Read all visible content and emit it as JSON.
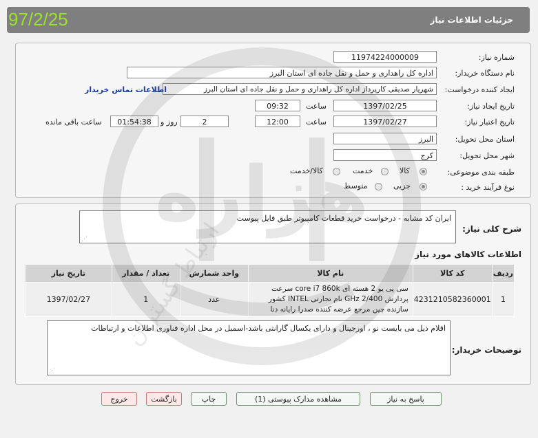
{
  "header": {
    "title": "جزئیات اطلاعات نیاز",
    "date_stamp": "97/2/25"
  },
  "form": {
    "need_number_label": "شماره نیاز:",
    "need_number": "11974224000009",
    "buyer_org_label": "نام دستگاه خریدار:",
    "buyer_org": "اداره کل راهداری و حمل و نقل جاده ای استان البرز",
    "creator_label": "ایجاد کننده درخواست:",
    "creator": "شهریار  صدیقی  کارپرداز  اداره کل راهداری و حمل و نقل جاده ای استان البرز",
    "contact_link": "اطلاعات تماس خریدار",
    "created_date_label": "تاریخ ایجاد نیاز:",
    "created_date": "1397/02/25",
    "time_label": "ساعت",
    "created_time": "09:32",
    "valid_date_label": "تاریخ اعتبار نیاز:",
    "valid_date": "1397/02/27",
    "valid_time": "12:00",
    "days": "2",
    "days_label": "روز و",
    "remaining_time": "01:54:38",
    "remaining_label": "ساعت باقی مانده",
    "province_label": "استان محل تحویل:",
    "province": "البرز",
    "city_label": "شهر محل تحویل:",
    "city": "کرج",
    "category_label": "طبقه بندی موضوعی:",
    "category_options": [
      "کالا",
      "خدمت",
      "کالا/خدمت"
    ],
    "category_selected": 0,
    "process_label": "نوع فرآیند خرید :",
    "process_options": [
      "جزیی",
      "متوسط"
    ],
    "process_selected": 0
  },
  "description": {
    "label": "شرح کلی نیاز:",
    "text": "ایران کد مشابه - درخواست خرید قطعات کامپیوتر طبق فایل پیوست"
  },
  "items_section": {
    "title": "اطلاعات کالاهای مورد نیاز",
    "columns": [
      "ردیف",
      "کد کالا",
      "نام کالا",
      "واحد شمارش",
      "تعداد / مقدار",
      "تاریخ نیاز"
    ],
    "rows": [
      {
        "row": "1",
        "code": "4231210582360001",
        "name": "سی پی یو 2 هسته ای core i7 860k سرعت پردازش 2/400 GHz نام تجارتی INTEL کشور سازنده چین مرجع عرضه کننده صدرا رایانه دنا",
        "unit": "عدد",
        "qty": "1",
        "date": "1397/02/27"
      }
    ]
  },
  "buyer_notes": {
    "label": "توضیحات خریدار:",
    "text": "اقلام ذیل می بایست نو ، اورجینال و دارای یکسال گارانتی باشد-اسمبل در محل اداره فناوری اطلاعات و ارتباطات"
  },
  "buttons": {
    "reply": "پاسخ به نیاز",
    "view_docs": "مشاهده مدارک پیوستی (1)",
    "print": "چاپ",
    "back": "بازگشت",
    "exit": "خروج"
  },
  "watermark": {
    "text": "هزاره",
    "subtext": "ارتباط گستران"
  },
  "colors": {
    "header_bg": "#7f7f7f",
    "date_stamp": "#9be22a",
    "link": "#1a3ea8",
    "accent_green": "#6f8f6f",
    "exit_red": "#c57a7a"
  }
}
